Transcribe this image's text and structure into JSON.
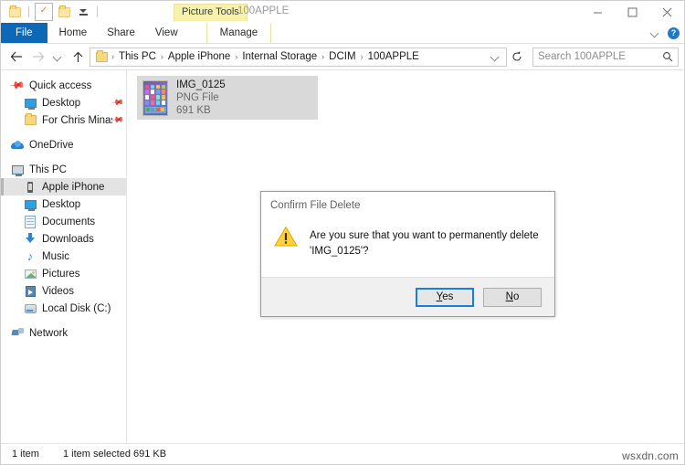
{
  "window": {
    "contextual_header": "Picture Tools",
    "title": "100APPLE",
    "controls": {
      "minimize": "minimize-icon",
      "maximize": "maximize-icon",
      "close": "close-icon"
    },
    "quick_access": [
      {
        "name": "quick-access-folder",
        "icon": "folder-icon"
      },
      {
        "name": "quick-access-properties",
        "icon": "check-folder-icon"
      },
      {
        "name": "quick-access-new-folder",
        "icon": "folder-icon"
      },
      {
        "name": "quick-access-customize",
        "icon": "caret-down-icon"
      }
    ]
  },
  "ribbon": {
    "tabs": [
      {
        "label": "File",
        "id": "file"
      },
      {
        "label": "Home",
        "id": "home"
      },
      {
        "label": "Share",
        "id": "share"
      },
      {
        "label": "View",
        "id": "view"
      },
      {
        "label": "Manage",
        "id": "manage"
      }
    ],
    "collapse_icon": "chevron-down-icon",
    "help_label": "?"
  },
  "addressbar": {
    "back_icon": "arrow-left-icon",
    "forward_icon": "arrow-right-icon",
    "recent_icon": "chevron-down-icon",
    "up_icon": "arrow-up-icon",
    "breadcrumbs": [
      "This PC",
      "Apple iPhone",
      "Internal Storage",
      "DCIM",
      "100APPLE"
    ],
    "separator": "›",
    "dropdown_icon": "chevron-down-icon",
    "refresh_icon": "refresh-icon",
    "search": {
      "placeholder": "Search 100APPLE",
      "value": "",
      "icon": "search-icon"
    }
  },
  "navpane": {
    "groups": [
      {
        "items": [
          {
            "label": "Quick access",
            "icon": "pin-icon",
            "level": "root",
            "pinned": false,
            "selected": false
          },
          {
            "label": "Desktop",
            "icon": "monitor-icon",
            "level": "child",
            "pinned": true,
            "selected": false
          },
          {
            "label": "For Chris Minasi:",
            "icon": "folder-icon",
            "level": "child",
            "pinned": true,
            "selected": false
          }
        ]
      },
      {
        "items": [
          {
            "label": "OneDrive",
            "icon": "cloud-icon",
            "level": "root",
            "pinned": false,
            "selected": false
          }
        ]
      },
      {
        "items": [
          {
            "label": "This PC",
            "icon": "pc-icon",
            "level": "root",
            "pinned": false,
            "selected": false
          },
          {
            "label": "Apple iPhone",
            "icon": "phone-icon",
            "level": "child",
            "pinned": false,
            "selected": true
          },
          {
            "label": "Desktop",
            "icon": "monitor-icon",
            "level": "child",
            "pinned": false,
            "selected": false
          },
          {
            "label": "Documents",
            "icon": "documents-icon",
            "level": "child",
            "pinned": false,
            "selected": false
          },
          {
            "label": "Downloads",
            "icon": "download-icon",
            "level": "child",
            "pinned": false,
            "selected": false
          },
          {
            "label": "Music",
            "icon": "music-icon",
            "level": "child",
            "pinned": false,
            "selected": false
          },
          {
            "label": "Pictures",
            "icon": "pictures-icon",
            "level": "child",
            "pinned": false,
            "selected": false
          },
          {
            "label": "Videos",
            "icon": "videos-icon",
            "level": "child",
            "pinned": false,
            "selected": false
          },
          {
            "label": "Local Disk (C:)",
            "icon": "disk-icon",
            "level": "child",
            "pinned": false,
            "selected": false
          }
        ]
      },
      {
        "items": [
          {
            "label": "Network",
            "icon": "network-icon",
            "level": "root",
            "pinned": false,
            "selected": false
          }
        ]
      }
    ]
  },
  "content": {
    "files": [
      {
        "name": "IMG_0125",
        "type": "PNG File",
        "size": "691 KB",
        "thumbnail": "iphone-home-screen-thumbnail",
        "selected": true
      }
    ]
  },
  "dialog": {
    "title": "Confirm File Delete",
    "icon": "warning-icon",
    "message": "Are you sure that you want to permanently delete 'IMG_0125'?",
    "buttons": [
      {
        "id": "yes",
        "label": "Yes",
        "mnemonic": "Y",
        "rest": "es",
        "default": true
      },
      {
        "id": "no",
        "label": "No",
        "mnemonic": "N",
        "rest": "o",
        "default": false
      }
    ]
  },
  "statusbar": {
    "item_count": "1 item",
    "selection": "1 item selected  691 KB"
  },
  "watermark": "wsxdn.com",
  "colors": {
    "accent_file_tab": "#0d68b8",
    "contextual_header": "#f6f2ac",
    "selection": "#d9d9d9",
    "default_button_border": "#1a7fd4",
    "warning_yellow": "#ffd23b"
  }
}
